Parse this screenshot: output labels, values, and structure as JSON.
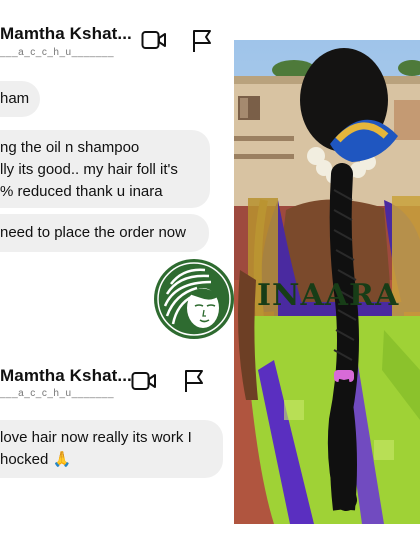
{
  "chat1": {
    "contact_name": "Mamtha Kshat...",
    "username": "___a_c_c_h_u_______",
    "messages": [
      "ham",
      "ng the oil n shampoo",
      "lly its good.. my hair foll it's",
      "% reduced thank u inara",
      "need to place the order now"
    ]
  },
  "chat2": {
    "contact_name": "Mamtha Kshat...",
    "username": "___a_c_c_h_u_______",
    "messages": [
      "love hair now really its work I",
      "hocked 🙏"
    ]
  },
  "brand": {
    "name": "INAARA",
    "color": "#173d17",
    "logo_color": "#2e6b30"
  },
  "icons": [
    "video-call-icon",
    "flag-icon"
  ]
}
